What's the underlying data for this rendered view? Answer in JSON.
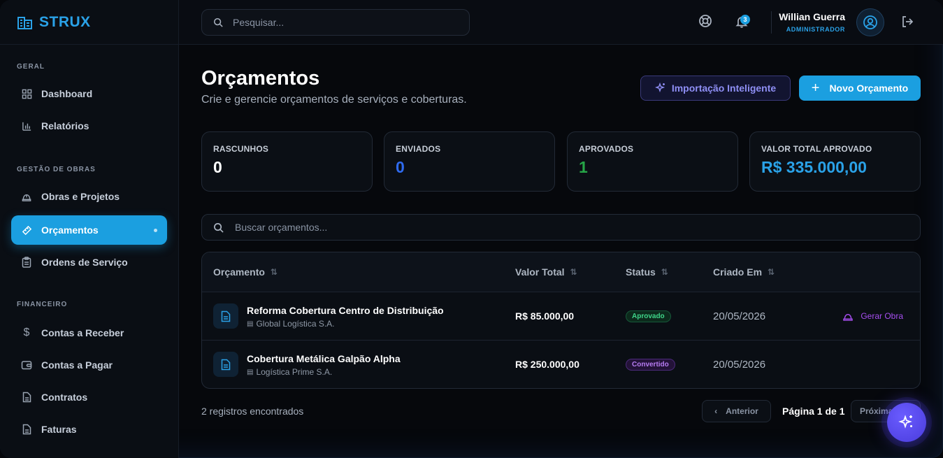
{
  "app": {
    "brand": "STRUX"
  },
  "sidebar": {
    "sections": [
      {
        "title": "GERAL",
        "items": [
          {
            "label": "Dashboard",
            "icon": "grid-icon"
          },
          {
            "label": "Relatórios",
            "icon": "bar-chart-icon"
          }
        ]
      },
      {
        "title": "GESTÃO DE OBRAS",
        "items": [
          {
            "label": "Obras e Projetos",
            "icon": "hard-hat-icon"
          },
          {
            "label": "Orçamentos",
            "icon": "ruler-icon",
            "active": true
          },
          {
            "label": "Ordens de Serviço",
            "icon": "clipboard-icon"
          }
        ]
      },
      {
        "title": "FINANCEIRO",
        "items": [
          {
            "label": "Contas a Receber",
            "icon": "dollar-icon"
          },
          {
            "label": "Contas a Pagar",
            "icon": "wallet-icon"
          },
          {
            "label": "Contratos",
            "icon": "document-icon"
          },
          {
            "label": "Faturas",
            "icon": "document-icon"
          }
        ]
      }
    ]
  },
  "topbar": {
    "search_placeholder": "Pesquisar...",
    "notifications_count": "3",
    "user_name": "Willian Guerra",
    "user_role": "ADMINISTRADOR"
  },
  "page": {
    "title": "Orçamentos",
    "subtitle": "Crie e gerencie orçamentos de serviços e coberturas.",
    "import_button": "Importação Inteligente",
    "new_button": "Novo Orçamento"
  },
  "stats": [
    {
      "label": "RASCUNHOS",
      "value": "0",
      "color": "#ffffff"
    },
    {
      "label": "ENVIADOS",
      "value": "0",
      "color": "#2f6bf0"
    },
    {
      "label": "APROVADOS",
      "value": "1",
      "color": "#26a547"
    },
    {
      "label": "VALOR TOTAL APROVADO",
      "value": "R$ 335.000,00",
      "color": "#2aa2e8"
    }
  ],
  "list_search_placeholder": "Buscar orçamentos...",
  "table": {
    "columns": [
      "Orçamento",
      "Valor Total",
      "Status",
      "Criado Em"
    ],
    "rows": [
      {
        "title": "Reforma Cobertura Centro de Distribuição",
        "client": "Global Logística S.A.",
        "value": "R$ 85.000,00",
        "status": "Aprovado",
        "created": "20/05/2026",
        "action": "Gerar Obra"
      },
      {
        "title": "Cobertura Metálica Galpão Alpha",
        "client": "Logística Prime S.A.",
        "value": "R$ 250.000,00",
        "status": "Convertido",
        "created": "20/05/2026",
        "action": ""
      }
    ]
  },
  "footer": {
    "records": "2 registros encontrados",
    "prev": "Anterior",
    "page_label": "Página 1 de 1",
    "next": "Próxima"
  }
}
